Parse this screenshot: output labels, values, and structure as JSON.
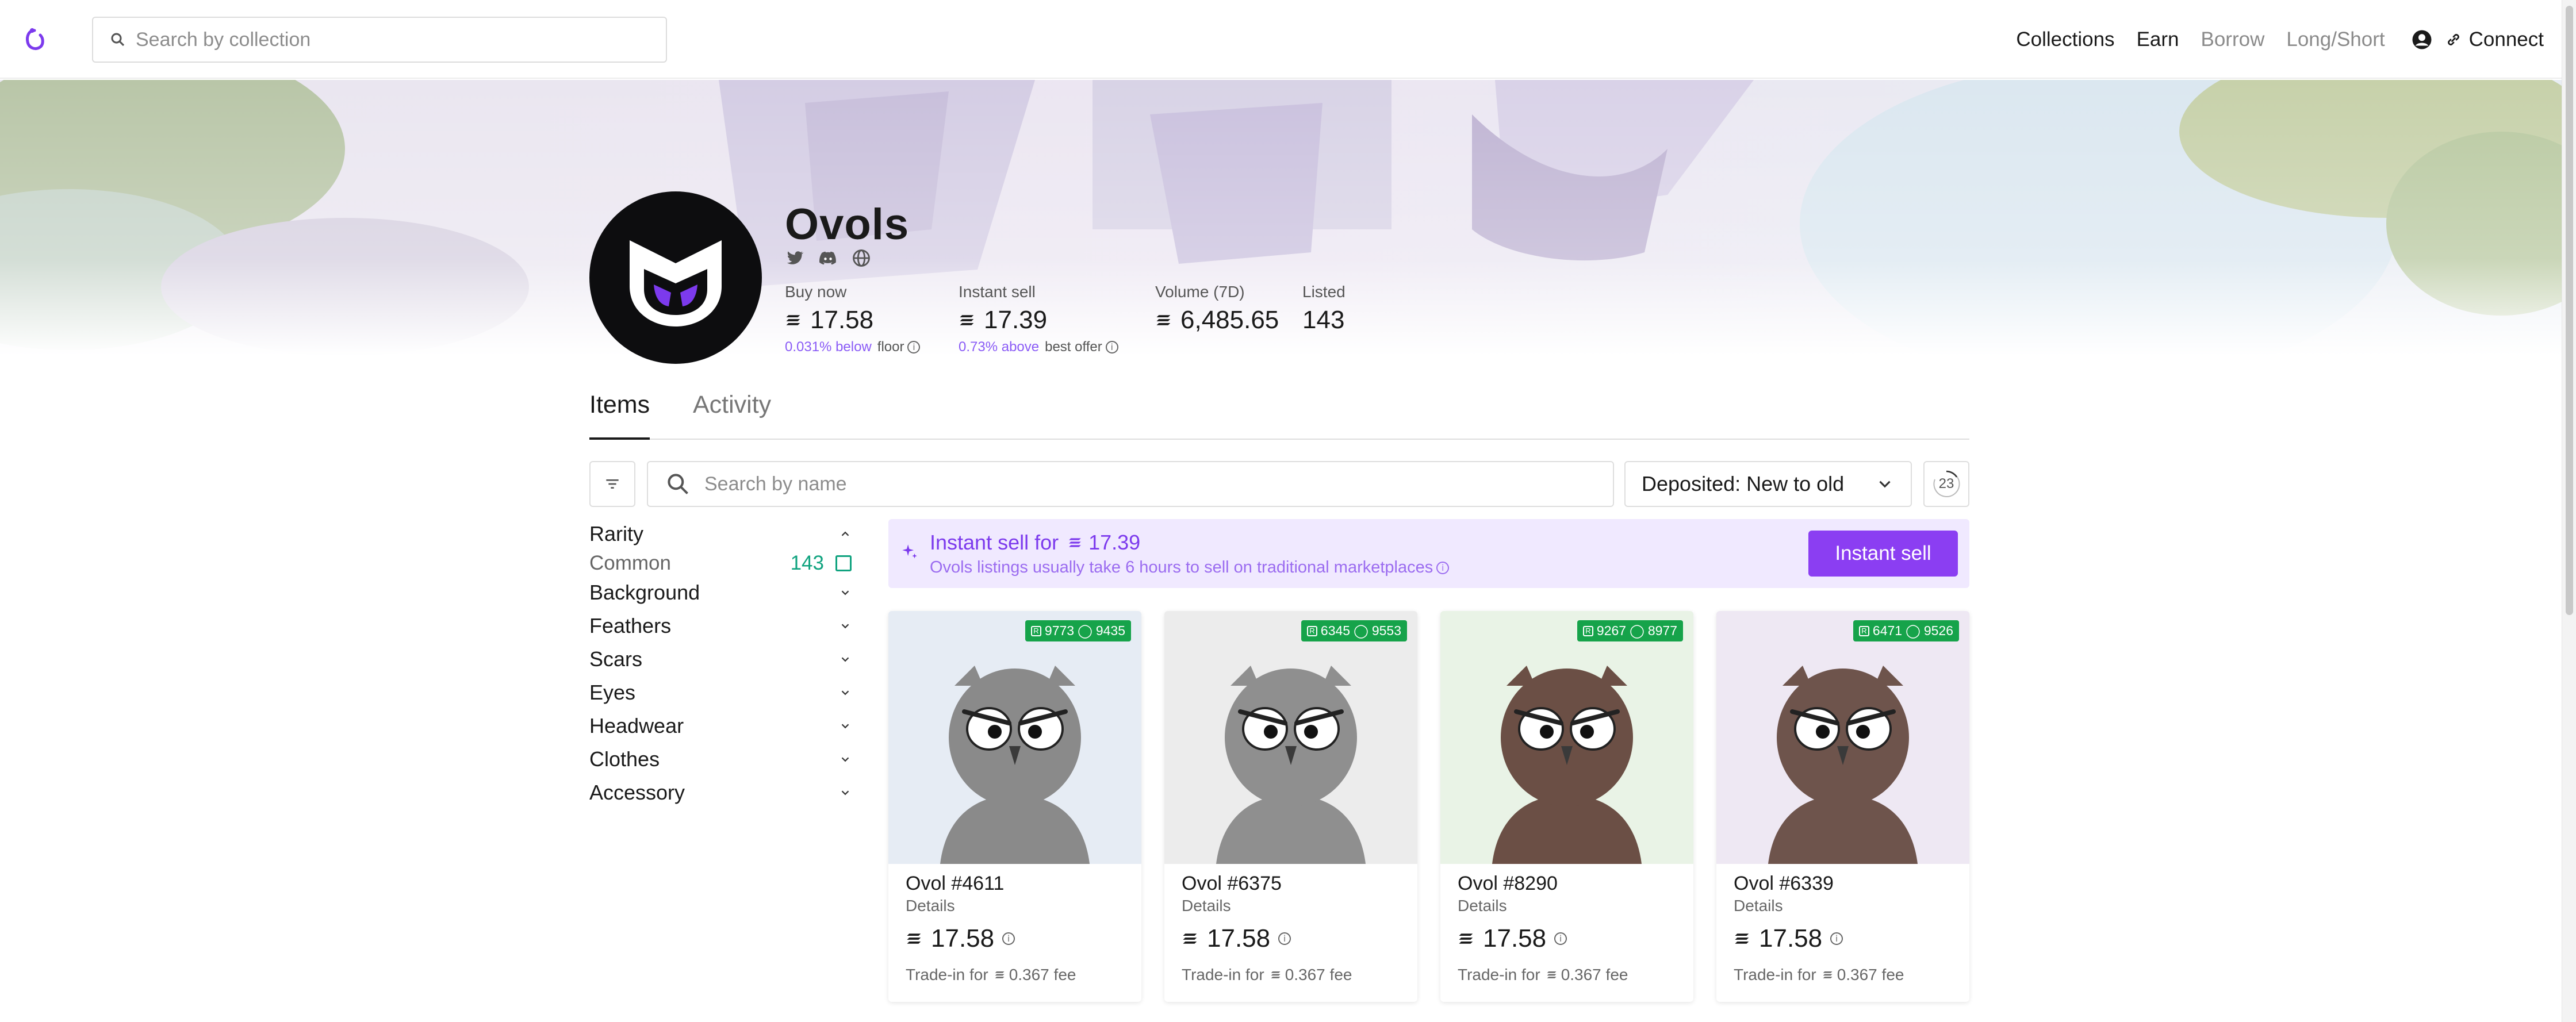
{
  "nav": {
    "search_placeholder": "Search by collection",
    "links": [
      "Collections",
      "Earn",
      "Borrow",
      "Long/Short"
    ],
    "connect_label": "Connect"
  },
  "collection": {
    "name": "Ovols",
    "stats": {
      "buy_now": {
        "label": "Buy now",
        "value": "17.58",
        "sub_pct": "0.031% below",
        "sub_text": "floor"
      },
      "instant_sell": {
        "label": "Instant sell",
        "value": "17.39",
        "sub_pct": "0.73% above",
        "sub_text": "best offer"
      },
      "volume": {
        "label": "Volume (7D)",
        "value": "6,485.65"
      },
      "listed": {
        "label": "Listed",
        "value": "143"
      }
    }
  },
  "tabs": [
    "Items",
    "Activity"
  ],
  "toolbar": {
    "search_placeholder": "Search by name",
    "sort_label": "Deposited: New to old",
    "refresh_count": "23"
  },
  "sidebar": {
    "rarity": {
      "label": "Rarity",
      "option": "Common",
      "count": "143"
    },
    "groups": [
      "Background",
      "Feathers",
      "Scars",
      "Eyes",
      "Headwear",
      "Clothes",
      "Accessory"
    ]
  },
  "instant_sell_banner": {
    "title_prefix": "Instant sell for",
    "title_value": "17.39",
    "subtitle": "Ovols listings usually take 6 hours to sell on traditional marketplaces",
    "button": "Instant sell"
  },
  "cards": [
    {
      "name": "Ovol #4611",
      "details": "Details",
      "price": "17.58",
      "trade_prefix": "Trade-in for",
      "trade_fee": "0.367 fee",
      "rank": "9773",
      "rank2": "9435",
      "bg": "#e6ecf4",
      "feather": "#8a8a8a"
    },
    {
      "name": "Ovol #6375",
      "details": "Details",
      "price": "17.58",
      "trade_prefix": "Trade-in for",
      "trade_fee": "0.367 fee",
      "rank": "6345",
      "rank2": "9553",
      "bg": "#ececec",
      "feather": "#8f8f8f"
    },
    {
      "name": "Ovol #8290",
      "details": "Details",
      "price": "17.58",
      "trade_prefix": "Trade-in for",
      "trade_fee": "0.367 fee",
      "rank": "9267",
      "rank2": "8977",
      "bg": "#e9f3e6",
      "feather": "#6b4f45"
    },
    {
      "name": "Ovol #6339",
      "details": "Details",
      "price": "17.58",
      "trade_prefix": "Trade-in for",
      "trade_fee": "0.367 fee",
      "rank": "6471",
      "rank2": "9526",
      "bg": "#eee8f3",
      "feather": "#6e544c"
    }
  ],
  "colors": {
    "accent": "#8b3ef2",
    "green": "#16a34a",
    "purple_text": "#8b5cf6"
  }
}
